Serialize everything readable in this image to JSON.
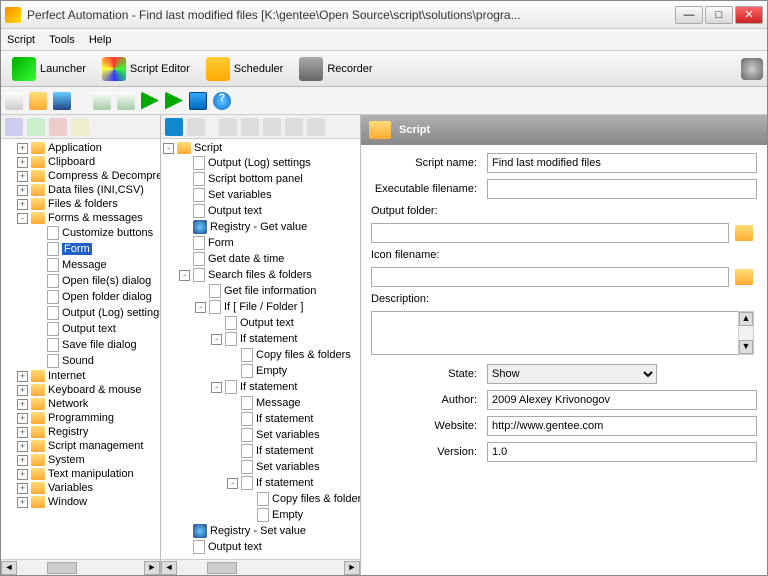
{
  "title": "Perfect Automation - Find last modified files [K:\\gentee\\Open Source\\script\\solutions\\progra...",
  "menu": {
    "script": "Script",
    "tools": "Tools",
    "help": "Help"
  },
  "toolbar": {
    "launcher": "Launcher",
    "scripteditor": "Script Editor",
    "scheduler": "Scheduler",
    "recorder": "Recorder"
  },
  "left_tree": [
    {
      "exp": "+",
      "icon": "folder",
      "label": "Application"
    },
    {
      "exp": "+",
      "icon": "folder",
      "label": "Clipboard"
    },
    {
      "exp": "+",
      "icon": "folder",
      "label": "Compress & Decompress"
    },
    {
      "exp": "+",
      "icon": "folder",
      "label": "Data files (INI,CSV)"
    },
    {
      "exp": "+",
      "icon": "folder",
      "label": "Files & folders"
    },
    {
      "exp": "-",
      "icon": "folder",
      "label": "Forms & messages",
      "children": [
        {
          "icon": "page",
          "label": "Customize buttons"
        },
        {
          "icon": "page",
          "label": "Form",
          "selected": true
        },
        {
          "icon": "page",
          "label": "Message"
        },
        {
          "icon": "page",
          "label": "Open file(s) dialog"
        },
        {
          "icon": "page",
          "label": "Open folder dialog"
        },
        {
          "icon": "page",
          "label": "Output (Log) settings"
        },
        {
          "icon": "page",
          "label": "Output text"
        },
        {
          "icon": "page",
          "label": "Save file dialog"
        },
        {
          "icon": "page",
          "label": "Sound"
        }
      ]
    },
    {
      "exp": "+",
      "icon": "folder",
      "label": "Internet"
    },
    {
      "exp": "+",
      "icon": "folder",
      "label": "Keyboard & mouse"
    },
    {
      "exp": "+",
      "icon": "folder",
      "label": "Network"
    },
    {
      "exp": "+",
      "icon": "folder",
      "label": "Programming"
    },
    {
      "exp": "+",
      "icon": "folder",
      "label": "Registry"
    },
    {
      "exp": "+",
      "icon": "folder",
      "label": "Script management"
    },
    {
      "exp": "+",
      "icon": "folder",
      "label": "System"
    },
    {
      "exp": "+",
      "icon": "folder",
      "label": "Text manipulation"
    },
    {
      "exp": "+",
      "icon": "folder",
      "label": "Variables"
    },
    {
      "exp": "+",
      "icon": "folder",
      "label": "Window"
    }
  ],
  "mid_tree": {
    "root": "Script",
    "items": [
      {
        "icon": "page",
        "label": "Output (Log) settings"
      },
      {
        "icon": "page",
        "label": "Script bottom panel"
      },
      {
        "icon": "page",
        "label": "Set variables"
      },
      {
        "icon": "page",
        "label": "Output text"
      },
      {
        "icon": "reg",
        "label": "Registry - Get value"
      },
      {
        "icon": "page",
        "label": "Form"
      },
      {
        "icon": "page",
        "label": "Get date & time"
      },
      {
        "exp": "-",
        "icon": "page",
        "label": "Search files & folders",
        "children": [
          {
            "icon": "page",
            "label": "Get file information"
          },
          {
            "exp": "-",
            "icon": "page",
            "label": "If [ File / Folder ]",
            "children": [
              {
                "icon": "page",
                "label": "Output text"
              },
              {
                "exp": "-",
                "icon": "page",
                "label": "If statement",
                "children": [
                  {
                    "icon": "page",
                    "label": "Copy files & folders"
                  },
                  {
                    "icon": "page",
                    "label": "Empty"
                  }
                ]
              },
              {
                "exp": "-",
                "icon": "page",
                "label": "If statement",
                "children": [
                  {
                    "icon": "page",
                    "label": "Message"
                  },
                  {
                    "icon": "page",
                    "label": "If statement"
                  },
                  {
                    "icon": "page",
                    "label": "Set variables"
                  },
                  {
                    "icon": "page",
                    "label": "If statement"
                  },
                  {
                    "icon": "page",
                    "label": "Set variables"
                  },
                  {
                    "exp": "-",
                    "icon": "page",
                    "label": "If statement",
                    "children": [
                      {
                        "icon": "page",
                        "label": "Copy files & folders"
                      },
                      {
                        "icon": "page",
                        "label": "Empty"
                      }
                    ]
                  }
                ]
              }
            ]
          }
        ]
      },
      {
        "icon": "reg",
        "label": "Registry - Set value"
      },
      {
        "icon": "page",
        "label": "Output text"
      }
    ]
  },
  "panel": {
    "header": "Script",
    "labels": {
      "script_name": "Script name:",
      "exec": "Executable filename:",
      "output_folder": "Output folder:",
      "icon_file": "Icon filename:",
      "desc": "Description:",
      "state": "State:",
      "author": "Author:",
      "website": "Website:",
      "version": "Version:"
    },
    "values": {
      "script_name": "Find last modified files",
      "exec": "",
      "output_folder": "",
      "icon_file": "",
      "desc": "",
      "state": "Show",
      "author": "2009 Alexey Krivonogov",
      "website": "http://www.gentee.com",
      "version": "1.0"
    }
  }
}
